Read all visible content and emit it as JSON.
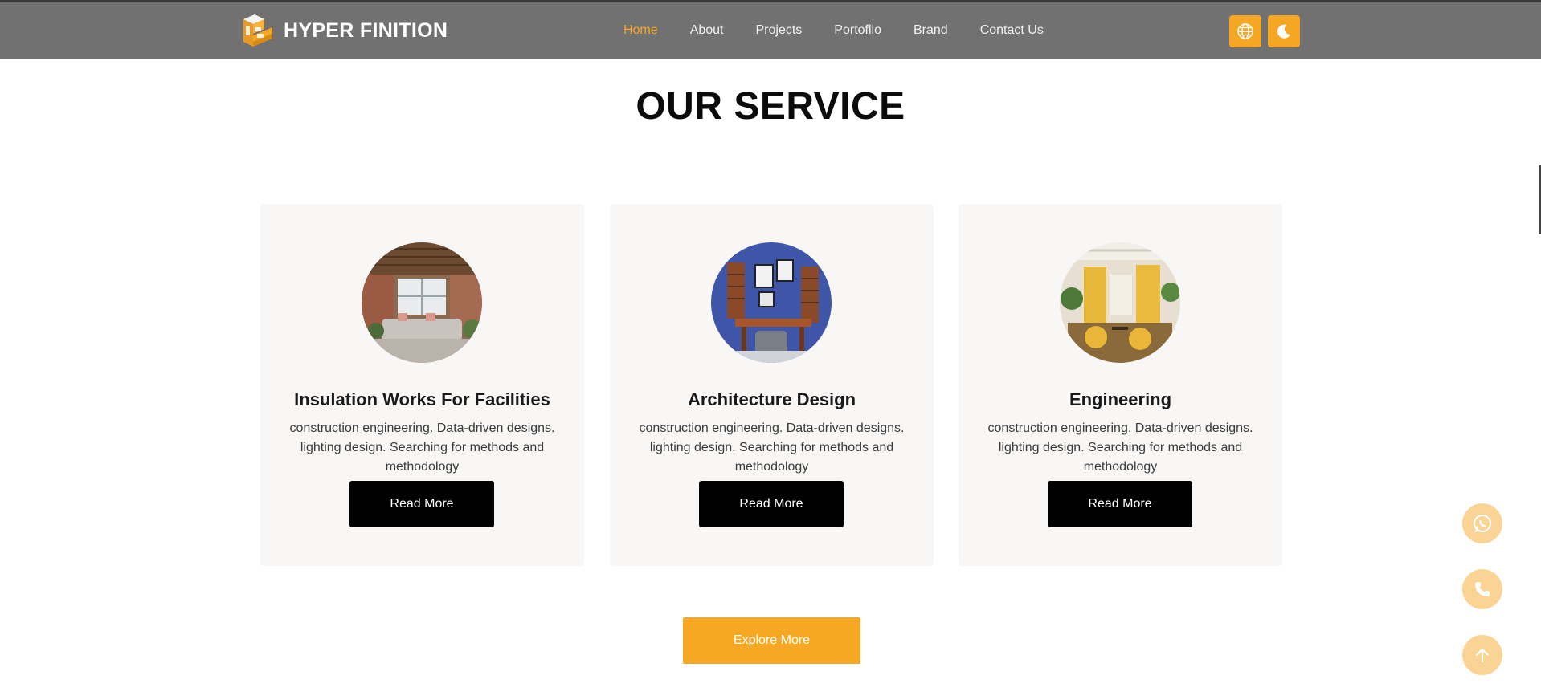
{
  "header": {
    "brand": "HYPER FINITION",
    "nav": [
      {
        "label": "Home",
        "active": true
      },
      {
        "label": "About",
        "active": false
      },
      {
        "label": "Projects",
        "active": false
      },
      {
        "label": "Portoflio",
        "active": false
      },
      {
        "label": "Brand",
        "active": false
      },
      {
        "label": "Contact Us",
        "active": false
      }
    ],
    "icons": {
      "language": "globe-icon",
      "theme": "moon-icon"
    }
  },
  "section": {
    "title": "OUR SERVICE"
  },
  "cards": [
    {
      "title": "Insulation Works For Facilities",
      "description": "construction engineering. Data-driven designs. lighting design. Searching for methods and methodology",
      "button": "Read More",
      "image": "living-room-photo"
    },
    {
      "title": "Architecture Design",
      "description": "construction engineering. Data-driven designs. lighting design. Searching for methods and methodology",
      "button": "Read More",
      "image": "office-photo"
    },
    {
      "title": "Engineering",
      "description": "construction engineering. Data-driven designs. lighting design. Searching for methods and methodology",
      "button": "Read More",
      "image": "restaurant-photo"
    }
  ],
  "explore_button": "Explore More",
  "floating": [
    "whatsapp-icon",
    "phone-icon",
    "arrow-up-icon"
  ],
  "colors": {
    "header_bg": "#727171",
    "accent": "#f5a623",
    "card_bg": "#f8f7f6",
    "button_dark": "#000000",
    "float_bg": "#fad494"
  }
}
